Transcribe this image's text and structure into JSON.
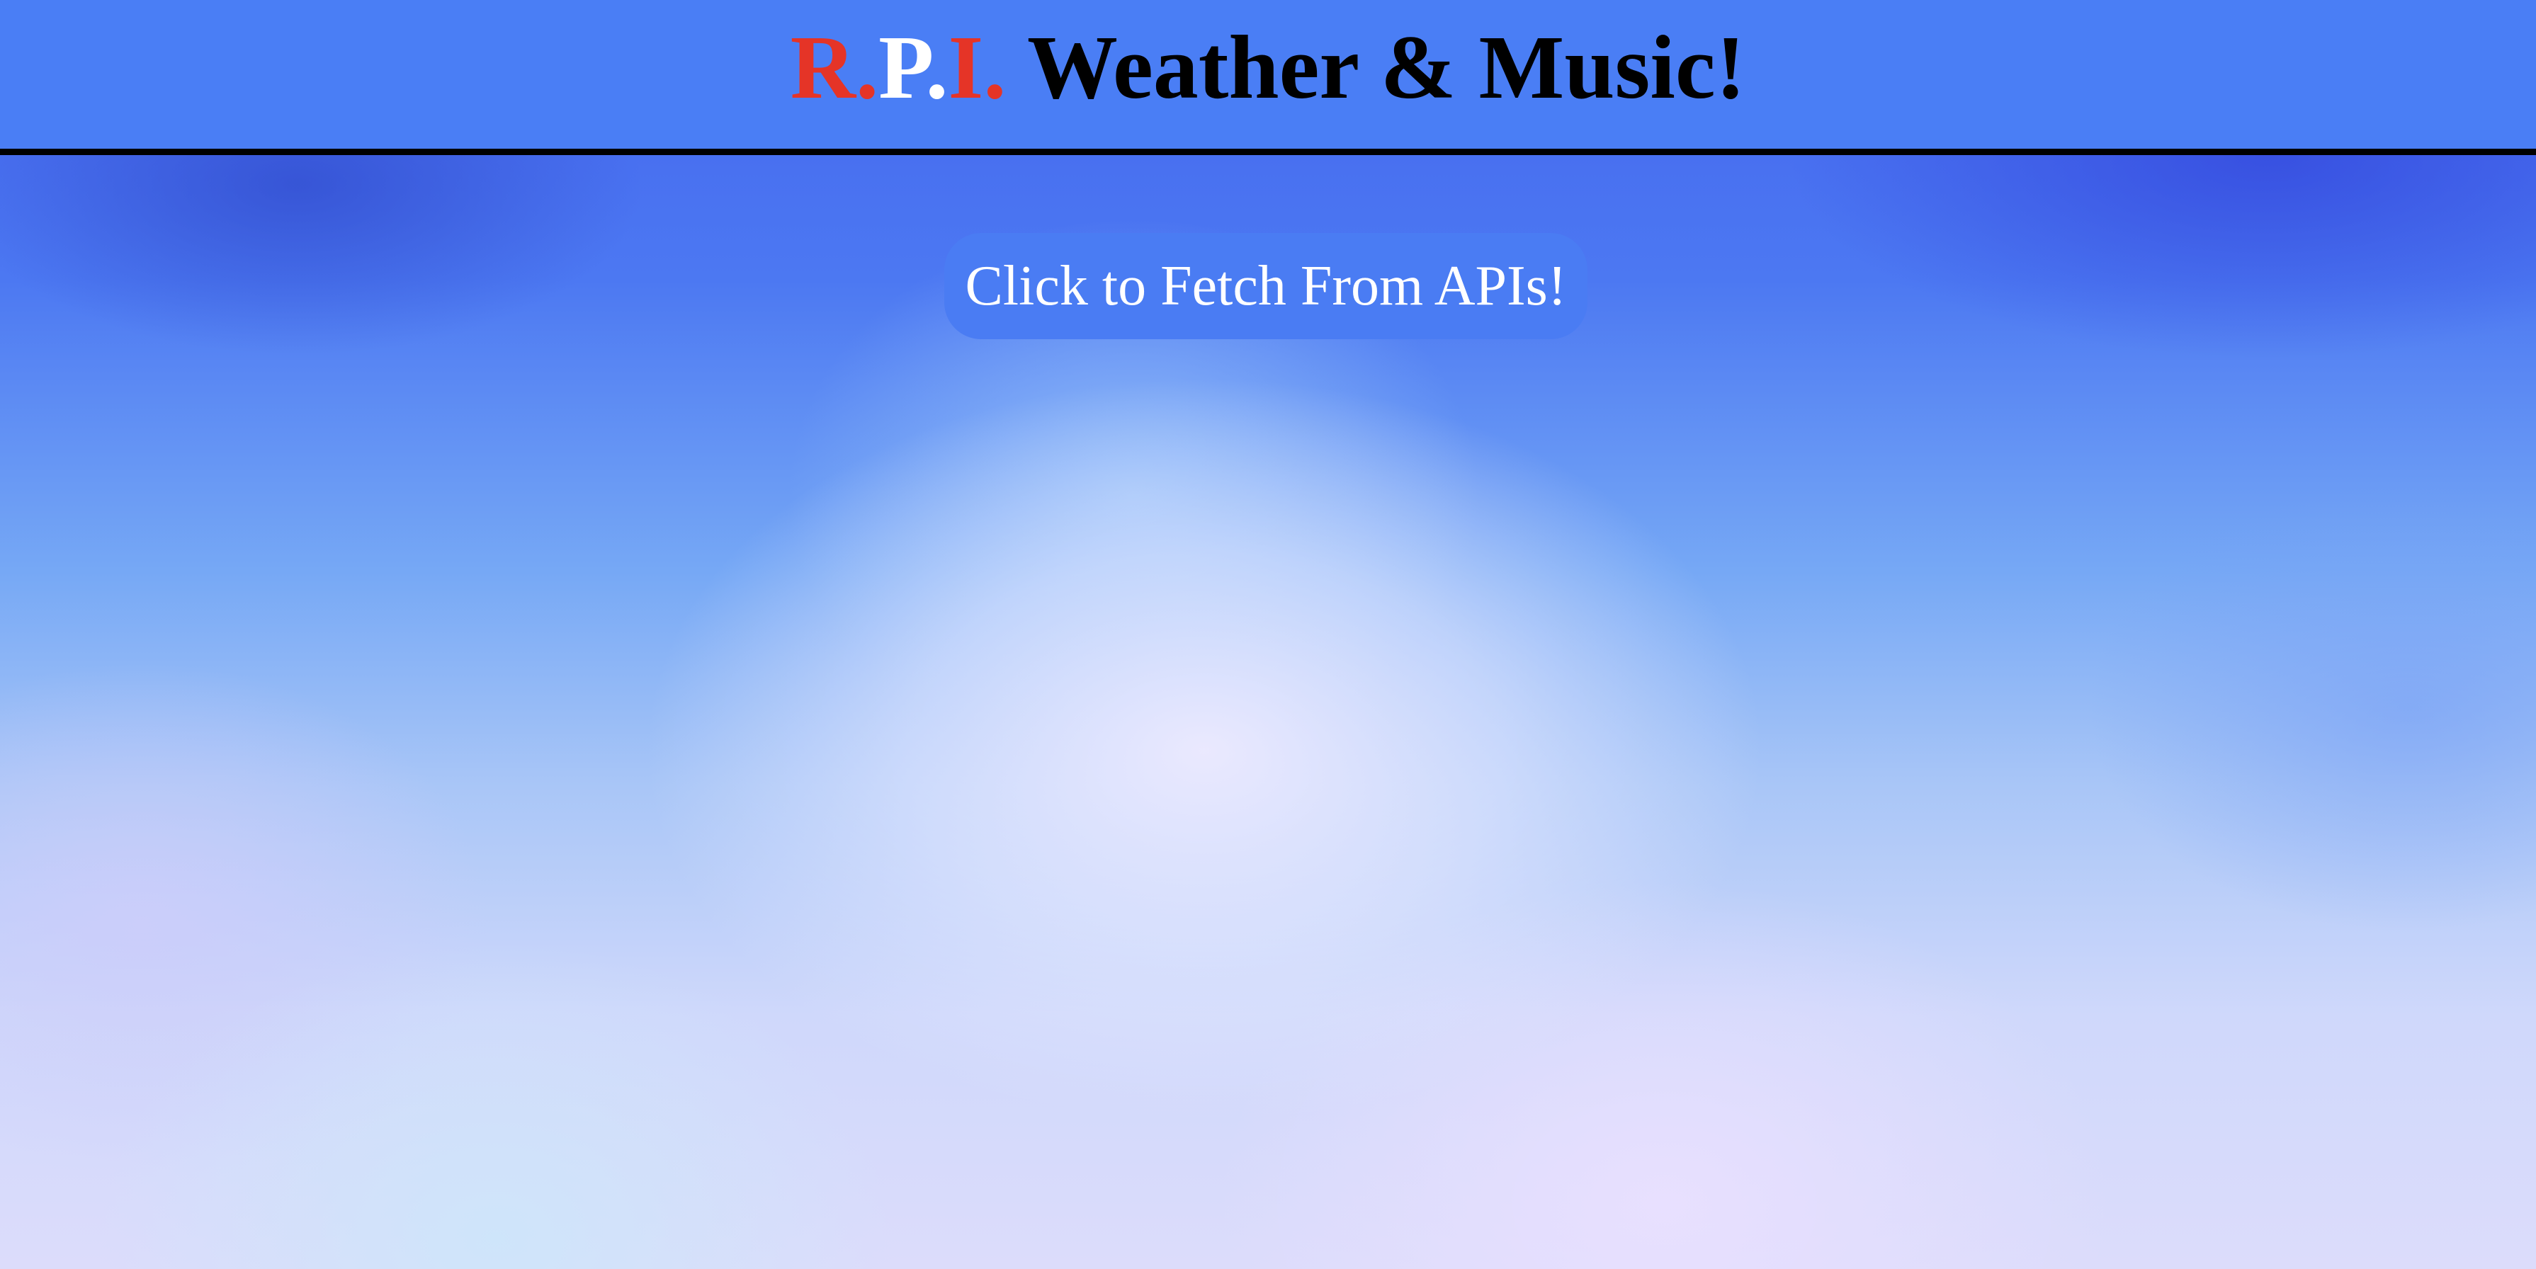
{
  "header": {
    "title_parts": {
      "r": "R",
      "dot1": ".",
      "p": "P",
      "dot2": ".",
      "i": "I",
      "dot3": ".",
      "rest": " Weather & Music!"
    }
  },
  "main": {
    "fetch_button_label": "Click to Fetch From APIs!"
  },
  "colors": {
    "header_bg": "#4a7ef5",
    "accent_red": "#e53427",
    "accent_white": "#ffffff",
    "title_black": "#000000",
    "button_bg": "#4a7cf3"
  }
}
